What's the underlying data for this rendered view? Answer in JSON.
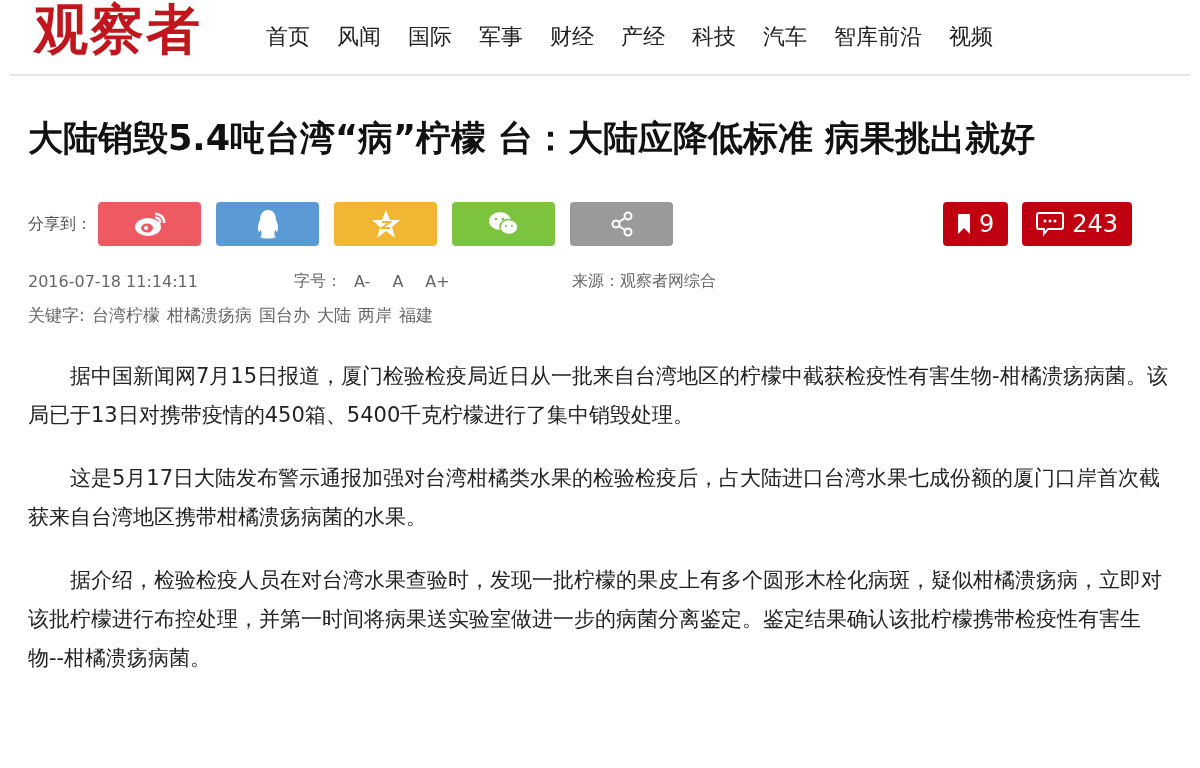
{
  "logo": "观察者",
  "nav": [
    "首页",
    "风闻",
    "国际",
    "军事",
    "财经",
    "产经",
    "科技",
    "汽车",
    "智库前沿",
    "视频"
  ],
  "headline": "大陆销毁5.4吨台湾“病”柠檬 台：大陆应降低标准 病果挑出就好",
  "share": {
    "label": "分享到：",
    "buttons": [
      {
        "kind": "weibo",
        "color": "#ee5a62"
      },
      {
        "kind": "qq",
        "color": "#5b9bd5"
      },
      {
        "kind": "qzone",
        "color": "#f2b632"
      },
      {
        "kind": "wechat",
        "color": "#7cc33e"
      },
      {
        "kind": "more",
        "color": "#9a9a9a"
      }
    ]
  },
  "counters": [
    {
      "kind": "bookmark",
      "count": "9"
    },
    {
      "kind": "comment",
      "count": "243"
    }
  ],
  "meta": {
    "date": "2016-07-18 11:14:11",
    "font_label": "字号：",
    "font_sizes": [
      "A-",
      "A",
      "A+"
    ],
    "source": "来源：观察者网综合"
  },
  "keywords": {
    "label": "关键字:",
    "items": [
      "台湾柠檬",
      "柑橘溃疡病",
      "国台办",
      "大陆",
      "两岸",
      "福建"
    ]
  },
  "paragraphs": [
    "据中国新闻网7月15日报道，厦门检验检疫局近日从一批来自台湾地区的柠檬中截获检疫性有害生物-柑橘溃疡病菌。该局已于13日对携带疫情的450箱、5400千克柠檬进行了集中销毁处理。",
    "这是5月17日大陆发布警示通报加强对台湾柑橘类水果的检验检疫后，占大陆进口台湾水果七成份额的厦门口岸首次截获来自台湾地区携带柑橘溃疡病菌的水果。",
    "据介绍，检验检疫人员在对台湾水果查验时，发现一批柠檬的果皮上有多个圆形木栓化病斑，疑似柑橘溃疡病，立即对该批柠檬进行布控处理，并第一时间将病果送实验室做进一步的病菌分离鉴定。鉴定结果确认该批柠檬携带检疫性有害生物--柑橘溃疡病菌。"
  ]
}
